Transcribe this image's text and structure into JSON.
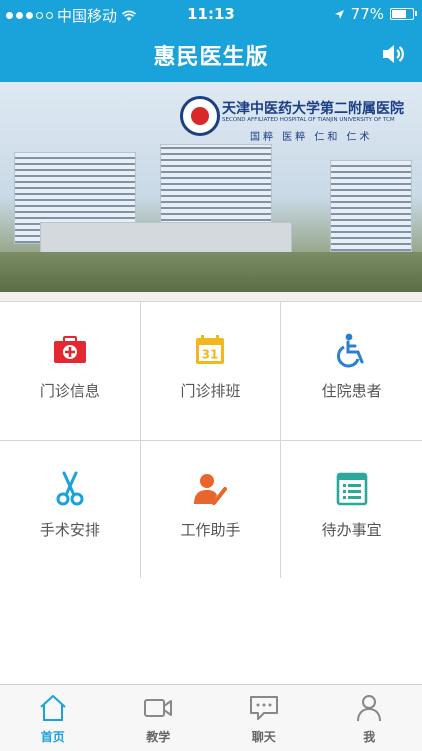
{
  "status_bar": {
    "carrier": "中国移动",
    "time": "11:13",
    "battery": "77%",
    "battery_level": 0.77
  },
  "header": {
    "title": "惠民医生版",
    "speaker_icon": "speaker-icon"
  },
  "banner": {
    "hospital_name": "天津中医药大学第二附属医院",
    "hospital_name_en": "SECOND AFFILIATED HOSPITAL OF TIANJIN UNIVERSITY OF TCM",
    "motto": "国粹 医粹 仁和 仁术",
    "page_count": 3,
    "active_page": 1
  },
  "menu": [
    {
      "label": "门诊信息",
      "icon": "first-aid-kit-icon",
      "color": "#e3292f"
    },
    {
      "label": "门诊排班",
      "icon": "calendar-icon",
      "color": "#f3b61d",
      "icon_text": "31"
    },
    {
      "label": "住院患者",
      "icon": "wheelchair-icon",
      "color": "#2b7fd1"
    },
    {
      "label": "手术安排",
      "icon": "scissors-icon",
      "color": "#1aa3db"
    },
    {
      "label": "工作助手",
      "icon": "worker-icon",
      "color": "#e8662b"
    },
    {
      "label": "待办事宜",
      "icon": "todo-list-icon",
      "color": "#2aa89d"
    }
  ],
  "tabs": [
    {
      "label": "首页",
      "icon": "home-icon",
      "active": true
    },
    {
      "label": "教学",
      "icon": "video-icon",
      "active": false
    },
    {
      "label": "聊天",
      "icon": "chat-icon",
      "active": false
    },
    {
      "label": "我",
      "icon": "person-icon",
      "active": false
    }
  ],
  "colors": {
    "accent": "#1aa3db",
    "text": "#555555",
    "divider": "#d6d6d6"
  }
}
